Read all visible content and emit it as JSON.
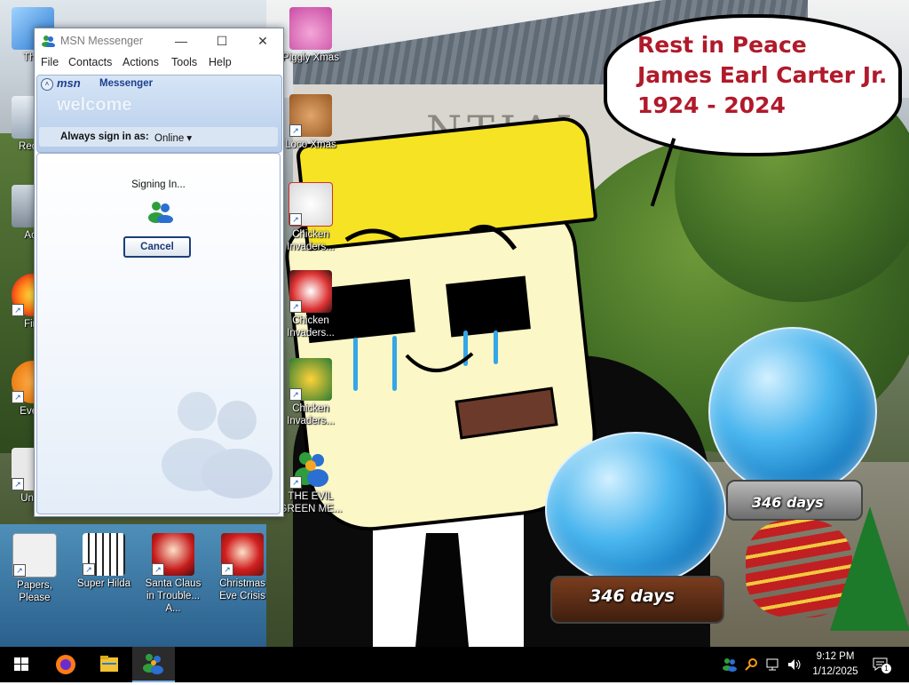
{
  "wallpaper": {
    "bubble_lines": [
      "Rest in Peace",
      "James Earl Carter Jr.",
      "1924 - 2024"
    ],
    "building_text": "NTIAL",
    "globe_left_days": "346 days",
    "globe_right_days": "346 days"
  },
  "desktop_icons": [
    {
      "name": "this-pc-icon",
      "label": "This",
      "icon": "computer-icon"
    },
    {
      "name": "recycle-bin-icon",
      "label": "Recyc",
      "icon": "recycle-bin-icon"
    },
    {
      "name": "activision-icon",
      "label": "Acti",
      "icon": "app-icon"
    },
    {
      "name": "firefox-desktop-icon",
      "label": "Fire",
      "icon": "firefox-icon"
    },
    {
      "name": "everything-icon",
      "label": "Every",
      "icon": "search-app-icon"
    },
    {
      "name": "undertale-icon",
      "label": "Unde",
      "icon": "game-icon"
    },
    {
      "name": "piggly-xmas-icon",
      "label": "Piggly Xmas",
      "icon": "pig-icon"
    },
    {
      "name": "loco-xmas-icon",
      "label": "Loco Xmas",
      "icon": "bear-icon"
    },
    {
      "name": "chicken-invaders-1-icon",
      "label": "Chicken Invaders...",
      "icon": "chicken-icon"
    },
    {
      "name": "chicken-invaders-2-icon",
      "label": "Chicken Invaders...",
      "icon": "chicken-icon"
    },
    {
      "name": "chicken-invaders-3-icon",
      "label": "Chicken Invaders...",
      "icon": "chicken-icon"
    },
    {
      "name": "the-evil-green-icon",
      "label": "THE EVIL GREEN ME...",
      "icon": "msn-buddy-icon"
    },
    {
      "name": "papers-please-icon",
      "label": "Papers, Please",
      "icon": "document-icon"
    },
    {
      "name": "super-hilda-icon",
      "label": "Super Hilda",
      "icon": "pixel-character-icon"
    },
    {
      "name": "santa-claus-trouble-icon",
      "label": "Santa Claus in Trouble... A...",
      "icon": "santa-icon"
    },
    {
      "name": "christmas-eve-crisis-icon",
      "label": "Christmas Eve Crisis",
      "icon": "santa-icon"
    }
  ],
  "msn": {
    "title": "MSN Messenger",
    "menu": [
      "File",
      "Contacts",
      "Actions",
      "Tools",
      "Help"
    ],
    "logo": "msn",
    "logo_sub": "Messenger",
    "welcome": "welcome",
    "signin_label": "Always sign in as:",
    "signin_status": "Online ▾",
    "signing_in": "Signing In...",
    "cancel": "Cancel"
  },
  "taskbar": {
    "time": "9:12 PM",
    "date": "1/12/2025",
    "notification_count": "1"
  },
  "colors": {
    "bubble_text": "#b01a2a",
    "msn_blue": "#1d3f8e",
    "taskbar": "#000000",
    "hat_yellow": "#f6e323"
  }
}
